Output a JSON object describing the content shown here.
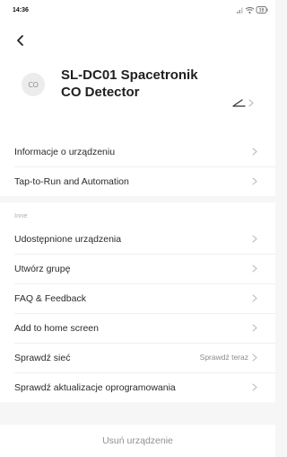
{
  "status_bar": {
    "time": "14:36",
    "icons": [
      "signal-icon",
      "wifi-icon",
      "battery-icon"
    ],
    "battery_level": "38"
  },
  "header": {
    "back_icon": "back-arrow-icon",
    "device_icon_text": "CO",
    "device_name": "SL-DC01 Spacetronik CO Detector",
    "edit_icon": "pencil-icon"
  },
  "top_list": {
    "items": [
      {
        "label": "Informacje o urządzeniu"
      },
      {
        "label": "Tap-to-Run and Automation"
      }
    ]
  },
  "other_section": {
    "title": "Inne",
    "items": [
      {
        "label": "Udostępnione urządzenia"
      },
      {
        "label": "Utwórz grupę"
      },
      {
        "label": "FAQ & Feedback"
      },
      {
        "label": "Add to home screen"
      },
      {
        "label": "Sprawdź sieć",
        "value": "Sprawdź teraz"
      },
      {
        "label": "Sprawdź aktualizacje oprogramowania"
      }
    ]
  },
  "remove_device": {
    "label": "Usuń urządzenie"
  },
  "colors": {
    "background": "#f6f6f6",
    "card": "#ffffff",
    "text": "#2b2b2b",
    "muted": "#8c8c8c",
    "chevron": "#b5b5b5"
  }
}
